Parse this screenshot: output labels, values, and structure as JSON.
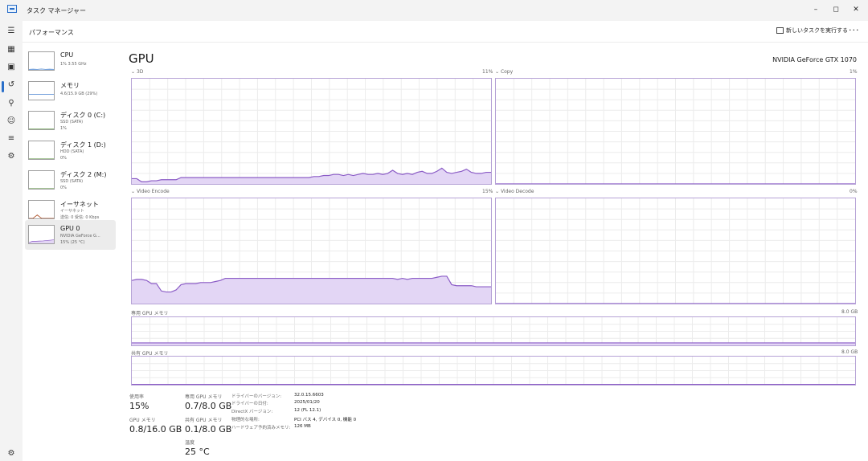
{
  "window": {
    "title": "タスク マネージャー",
    "controls": {
      "minimize": "–",
      "maximize": "◻",
      "close": "✕"
    }
  },
  "header": {
    "page_title": "パフォーマンス",
    "run_task_label": "新しいタスクを実行する",
    "more_label": "···"
  },
  "nav_rail": [
    {
      "icon": "hamburger-menu-icon"
    },
    {
      "icon": "processes-icon"
    },
    {
      "icon": "performance-icon"
    },
    {
      "icon": "app-history-icon"
    },
    {
      "icon": "startup-apps-icon"
    },
    {
      "icon": "users-icon"
    },
    {
      "icon": "details-icon"
    },
    {
      "icon": "services-icon"
    },
    {
      "icon": "settings-icon"
    }
  ],
  "sidebar": {
    "items": [
      {
        "name": "CPU",
        "sub1": "1%  3.55 GHz",
        "sub2": "",
        "spark": [
          97,
          96,
          97,
          95,
          97,
          96,
          97
        ],
        "color": "#2a6fc9"
      },
      {
        "name": "メモリ",
        "sub1": "4.6/15.9 GB (29%)",
        "sub2": "",
        "spark": [
          70,
          70,
          70,
          70,
          70,
          70,
          70
        ],
        "color": "#2a6fc9"
      },
      {
        "name": "ディスク 0 (C:)",
        "sub1": "SSD (SATA)",
        "sub2": "1%",
        "spark": [
          98,
          98,
          98,
          98,
          98,
          98,
          98
        ],
        "color": "#4d8c2e"
      },
      {
        "name": "ディスク 1 (D:)",
        "sub1": "HDD (SATA)",
        "sub2": "0%",
        "spark": [
          99,
          99,
          99,
          99,
          99,
          99,
          99
        ],
        "color": "#4d8c2e"
      },
      {
        "name": "ディスク 2 (M:)",
        "sub1": "SSD (SATA)",
        "sub2": "0%",
        "spark": [
          99,
          99,
          99,
          99,
          99,
          99,
          99
        ],
        "color": "#4d8c2e"
      },
      {
        "name": "イーサネット",
        "sub1": "イーサネット",
        "sub2": "送信: 0  受信: 0 Kbps",
        "spark": [
          99,
          99,
          80,
          99,
          99,
          99,
          99
        ],
        "color": "#a8461a"
      },
      {
        "name": "GPU 0",
        "sub1": "NVIDIA GeForce G...",
        "sub2": "15% (25 °C)",
        "spark": [
          96,
          88,
          88,
          87,
          86,
          84,
          82,
          80
        ],
        "color": "#8b5cc6"
      }
    ]
  },
  "main": {
    "title": "GPU",
    "model": "NVIDIA GeForce GTX 1070",
    "engines": [
      {
        "label": "3D",
        "max": "11%",
        "values": [
          5,
          5,
          2,
          2,
          3,
          3,
          4,
          4,
          4,
          4,
          6,
          6,
          6,
          6,
          6,
          6,
          6,
          6,
          6,
          6,
          6,
          6,
          6,
          6,
          6,
          6,
          6,
          6,
          6,
          6,
          6,
          6,
          6,
          6,
          6,
          6,
          6,
          7,
          7,
          8,
          8,
          9,
          9,
          8,
          9,
          8,
          9,
          10,
          9,
          9,
          10,
          9,
          10,
          13,
          10,
          9,
          10,
          9,
          11,
          12,
          10,
          10,
          12,
          15,
          11,
          10,
          11,
          12,
          14,
          11,
          10,
          10,
          11,
          11
        ]
      },
      {
        "label": "Copy",
        "max": "1%",
        "values": [
          0,
          0,
          0,
          0,
          0,
          0,
          0,
          0,
          0,
          0,
          0,
          0,
          0,
          0,
          0,
          0,
          0,
          0,
          0,
          0,
          0,
          0,
          0,
          0,
          0,
          0,
          0,
          0,
          0,
          0,
          0,
          0,
          0,
          0,
          0,
          0,
          0,
          0,
          0,
          0,
          0,
          0,
          0,
          0,
          0,
          0,
          0,
          0,
          0,
          0,
          0,
          0,
          0,
          0,
          0,
          0,
          0,
          0,
          0,
          0,
          0,
          0,
          0,
          0,
          0,
          0,
          0,
          0,
          0,
          0,
          0,
          0,
          0,
          0
        ]
      },
      {
        "label": "Video Encode",
        "max": "15%",
        "values": [
          22,
          23,
          23,
          22,
          19,
          19,
          12,
          11,
          11,
          13,
          18,
          19,
          19,
          19,
          20,
          20,
          20,
          21,
          22,
          24,
          24,
          24,
          24,
          24,
          24,
          24,
          24,
          24,
          24,
          24,
          24,
          24,
          24,
          24,
          24,
          24,
          24,
          24,
          24,
          24,
          24,
          24,
          24,
          24,
          24,
          24,
          24,
          24,
          24,
          24,
          24,
          24,
          24,
          24,
          23,
          24,
          23,
          24,
          24,
          24,
          24,
          24,
          25,
          26,
          26,
          18,
          17,
          17,
          17,
          17,
          16,
          16,
          16,
          16
        ]
      },
      {
        "label": "Video Decode",
        "max": "0%",
        "values": [
          0,
          0,
          0,
          0,
          0,
          0,
          0,
          0,
          0,
          0,
          0,
          0,
          0,
          0,
          0,
          0,
          0,
          0,
          0,
          0,
          0,
          0,
          0,
          0,
          0,
          0,
          0,
          0,
          0,
          0,
          0,
          0,
          0,
          0,
          0,
          0,
          0,
          0,
          0,
          0,
          0,
          0,
          0,
          0,
          0,
          0,
          0,
          0,
          0,
          0,
          0,
          0,
          0,
          0,
          0,
          0,
          0,
          0,
          0,
          0,
          0,
          0,
          0,
          0,
          0,
          0,
          0,
          0,
          0,
          0,
          0,
          0,
          0,
          0
        ]
      }
    ],
    "memory_graphs": [
      {
        "label": "専用 GPU メモリ",
        "max": "8.0 GB",
        "fill_fraction": 0.0875
      },
      {
        "label": "共有 GPU メモリ",
        "max": "8.0 GB",
        "fill_fraction": 0.0125
      }
    ],
    "stats": {
      "utilization_label": "使用率",
      "utilization": "15%",
      "dedicated_label": "専用 GPU メモリ",
      "dedicated": "0.7/8.0 GB",
      "gpu_memory_label": "GPU メモリ",
      "gpu_memory": "0.8/16.0 GB",
      "shared_label": "共有 GPU メモリ",
      "shared": "0.1/8.0 GB",
      "temp_label": "温度",
      "temp": "25 °C"
    },
    "details": [
      {
        "key": "ドライバーのバージョン:",
        "value": "32.0.15.6603"
      },
      {
        "key": "ドライバーの日付:",
        "value": "2025/01/20"
      },
      {
        "key": "DirectX バージョン:",
        "value": "12 (FL 12.1)"
      },
      {
        "key": "物理的な場所:",
        "value": "PCI バス 4, デバイス 0, 機能 0"
      },
      {
        "key": "ハードウェア予約済みメモリ:",
        "value": "126 MB"
      }
    ]
  },
  "colors": {
    "gpu_line": "#8b5cc6",
    "gpu_fill": "#e3d6f5",
    "grid": "#ececec",
    "border": "#b6a3d6",
    "accent": "#2a6fc9"
  }
}
